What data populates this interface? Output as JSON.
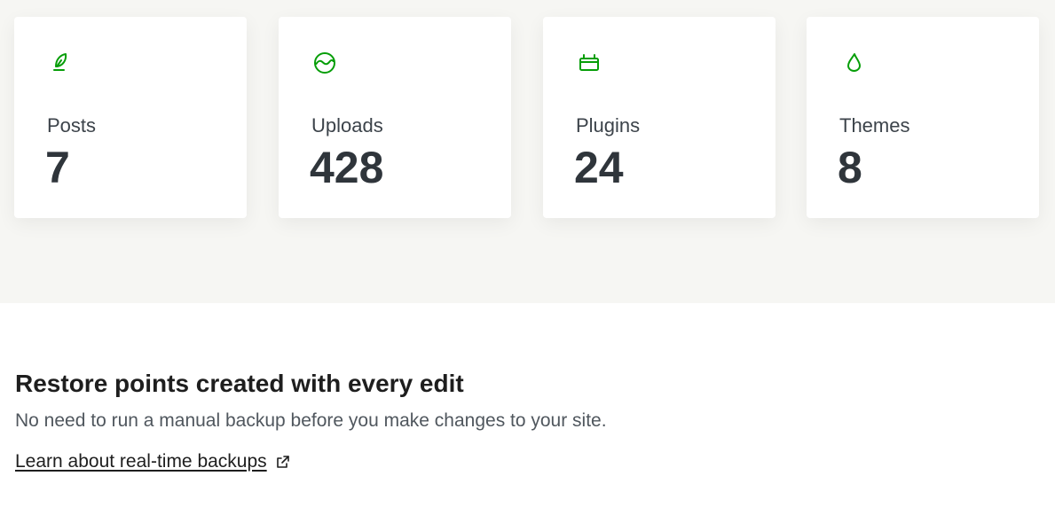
{
  "accent_color": "#069e08",
  "stats": [
    {
      "label": "Posts",
      "value": "7",
      "icon": "feather-icon"
    },
    {
      "label": "Uploads",
      "value": "428",
      "icon": "image-icon"
    },
    {
      "label": "Plugins",
      "value": "24",
      "icon": "plugin-icon"
    },
    {
      "label": "Themes",
      "value": "8",
      "icon": "droplet-icon"
    }
  ],
  "info": {
    "title": "Restore points created with every edit",
    "description": "No need to run a manual backup before you make changes to your site.",
    "link_text": "Learn about real-time backups",
    "link_icon": "external-link-icon"
  }
}
